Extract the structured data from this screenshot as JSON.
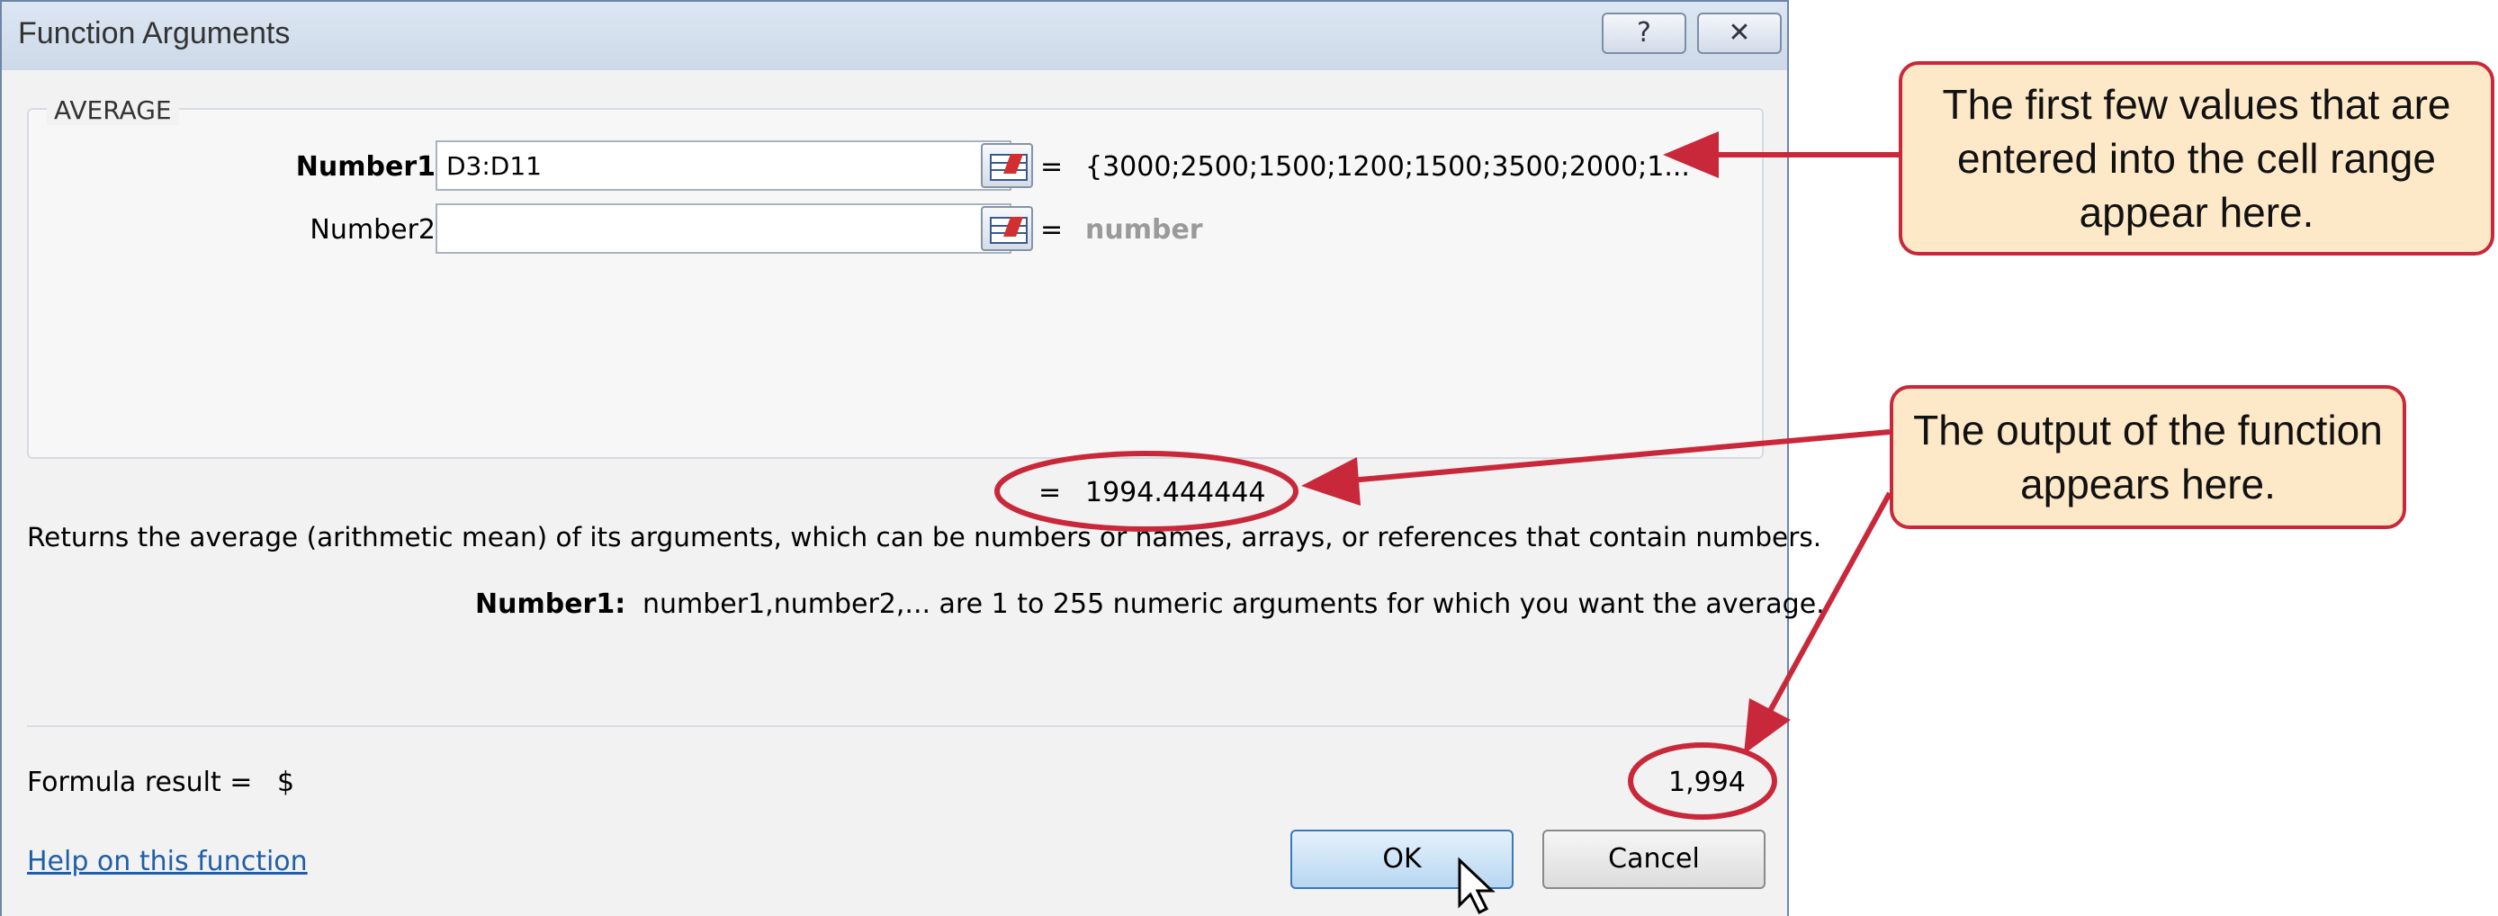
{
  "dialog": {
    "title": "Function Arguments",
    "help_button": "?",
    "close_button": "✕",
    "function_name": "AVERAGE",
    "arguments": [
      {
        "label": "Number1",
        "value": "D3:D11",
        "equals": "=",
        "preview": "{3000;2500;1500;1200;1500;3500;2000;1..."
      },
      {
        "label": "Number2",
        "value": "",
        "equals": "=",
        "preview": "number"
      }
    ],
    "result_equals": "=",
    "result_value": "1994.444444",
    "description": "Returns the average (arithmetic mean) of its arguments, which can be numbers or names, arrays, or references that contain numbers.",
    "arg_help_label": "Number1:",
    "arg_help_text": "number1,number2,... are 1 to 255 numeric arguments for which you want the average.",
    "formula_result_label": "Formula result =",
    "formula_result_currency": "$",
    "formula_result_value": "1,994",
    "help_link": "Help on this function",
    "ok_label": "OK",
    "cancel_label": "Cancel"
  },
  "callouts": {
    "values": "The first few values that are entered into the cell range appear here.",
    "output": "The output of the function appears here."
  },
  "colors": {
    "annotation_red": "#c8283a",
    "callout_fill": "#fde9c8",
    "link_blue": "#1f5fa8"
  }
}
